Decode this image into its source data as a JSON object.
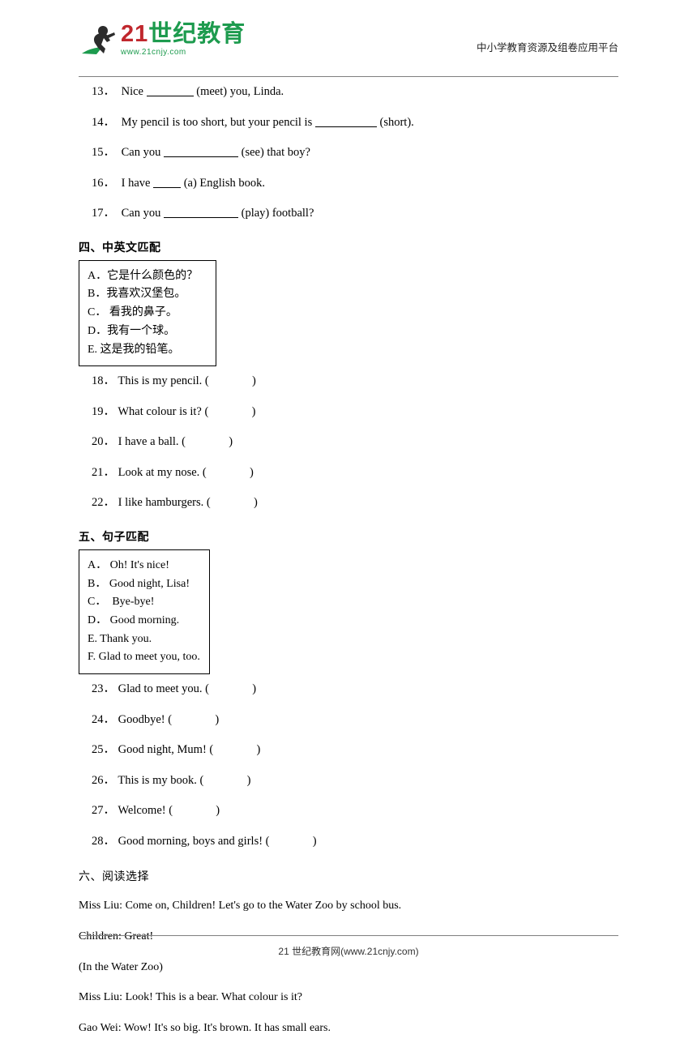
{
  "header": {
    "logo_cn_main": "21",
    "logo_cn_rest": "世纪教育",
    "logo_url": "www.21cnjy.com",
    "right_text": "中小学教育资源及组卷应用平台"
  },
  "fill_blanks": [
    {
      "num": "13．",
      "pre": "Nice",
      "blank": "blank-6",
      "post": "(meet) you, Linda."
    },
    {
      "num": "14．",
      "pre": "My pencil is too short, but your pencil is",
      "blank": "blank-8",
      "post": "(short)."
    },
    {
      "num": "15．",
      "pre": "Can you",
      "blank": "blank-10",
      "post": "(see) that boy?"
    },
    {
      "num": "16．",
      "pre": "I have",
      "blank": "blank-4",
      "post": "(a) English book."
    },
    {
      "num": "17．",
      "pre": "Can you",
      "blank": "blank-10",
      "post": "(play) football?"
    }
  ],
  "section4": {
    "title": "四、中英文匹配",
    "options": [
      "A．它是什么颜色的？",
      "B．我喜欢汉堡包。",
      "C． 看我的鼻子。",
      "D．我有一个球。",
      "E. 这是我的铅笔。"
    ],
    "questions": [
      {
        "num": "18．",
        "text": "This is my pencil. (",
        "close": ")"
      },
      {
        "num": "19．",
        "text": "What colour is it? (",
        "close": ")"
      },
      {
        "num": "20．",
        "text": "I have a ball. (",
        "close": ")"
      },
      {
        "num": "21．",
        "text": "Look at my nose. (",
        "close": ")"
      },
      {
        "num": "22．",
        "text": "I like hamburgers. (",
        "close": ")"
      }
    ]
  },
  "section5": {
    "title": "五、句子匹配",
    "options": [
      "A． Oh! It's nice!",
      "B． Good night, Lisa!",
      "C．  Bye-bye!",
      "D． Good morning.",
      "E. Thank you.",
      "F. Glad to meet you, too."
    ],
    "questions": [
      {
        "num": "23．",
        "text": "Glad to meet you. (",
        "close": ")"
      },
      {
        "num": "24．",
        "text": "Goodbye! (",
        "close": ")"
      },
      {
        "num": "25．",
        "text": "Good night, Mum! (",
        "close": ")"
      },
      {
        "num": "26．",
        "text": "This is my book. (",
        "close": ")"
      },
      {
        "num": "27．",
        "text": "Welcome! (",
        "close": ")"
      },
      {
        "num": "28．",
        "text": "Good morning, boys and girls! (",
        "close": ")"
      }
    ]
  },
  "section6": {
    "title": "六、阅读选择",
    "lines": [
      "Miss Liu: Come on, Children! Let's go to the Water Zoo by school bus.",
      "Children: Great!",
      "(In the Water Zoo)",
      "Miss Liu: Look! This is a bear. What colour is it?",
      "Gao Wei: Wow! It's so big. It's brown. It has small ears."
    ]
  },
  "footer": {
    "text": "21 世纪教育网(www.21cnjy.com)"
  }
}
